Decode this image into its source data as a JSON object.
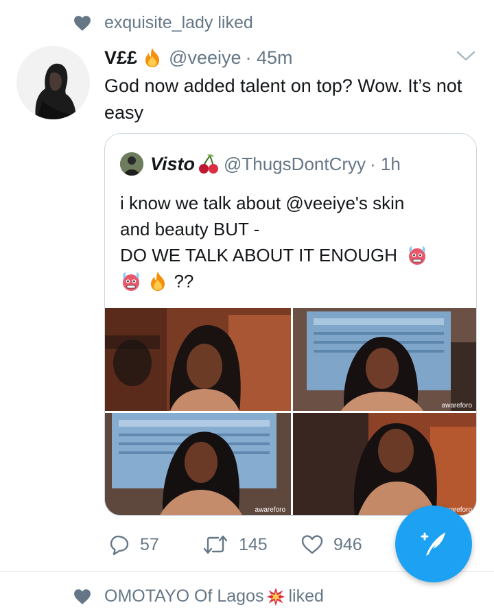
{
  "activity_top": {
    "text": "exquisite_lady liked"
  },
  "tweet": {
    "name": "V££",
    "handle": "@veeiye",
    "time": "· 45m",
    "text": "God now added talent on top? Wow. It’s not easy"
  },
  "quoted_tweet": {
    "name": "Visto",
    "handle": "@ThugsDontCryy",
    "time": "· 1h",
    "line1": "i know we talk about @veeiye's skin",
    "line2": "and beauty BUT -",
    "line3": "DO WE TALK ABOUT IT ENOUGH",
    "line4_tail": "??",
    "media_watermarks": [
      "awareforo",
      "awareforo",
      "awareforo"
    ]
  },
  "actions": {
    "replies": "57",
    "retweets": "145",
    "likes": "946"
  },
  "activity_bottom": {
    "name": "OMOTAYO Of Lagos",
    "suffix": "liked"
  },
  "icons": {
    "heart": "heart-icon",
    "reply": "reply-icon",
    "retweet": "retweet-icon",
    "like": "like-icon",
    "caret": "chevron-down-icon",
    "compose": "compose-tweet-icon",
    "fire": "fire-emoji",
    "cherries": "cherries-emoji",
    "cold_face": "cold-face-emoji",
    "collision": "collision-emoji"
  },
  "colors": {
    "brand": "#1da1f2",
    "muted": "#657786",
    "text": "#14171a",
    "border": "#ccd6dd"
  }
}
